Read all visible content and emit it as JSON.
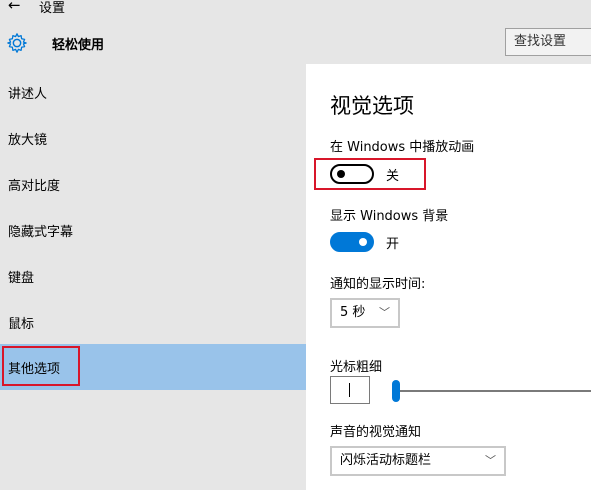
{
  "titlebar": {
    "back_glyph": "←",
    "app_title": "设置"
  },
  "header": {
    "icon": "gear-icon",
    "section_title": "轻松使用",
    "search_placeholder": "查找设置"
  },
  "sidebar": {
    "items": [
      {
        "label": "讲述人",
        "selected": false
      },
      {
        "label": "放大镜",
        "selected": false
      },
      {
        "label": "高对比度",
        "selected": false
      },
      {
        "label": "隐藏式字幕",
        "selected": false
      },
      {
        "label": "键盘",
        "selected": false
      },
      {
        "label": "鼠标",
        "selected": false
      },
      {
        "label": "其他选项",
        "selected": true
      }
    ]
  },
  "main": {
    "title": "视觉选项",
    "animations": {
      "label": "在 Windows 中播放动画",
      "state_text": "关",
      "on": false
    },
    "background": {
      "label": "显示 Windows 背景",
      "state_text": "开",
      "on": true
    },
    "notification": {
      "label": "通知的显示时间:",
      "value": "5 秒"
    },
    "cursor": {
      "label": "光标粗细",
      "thickness": 1
    },
    "sound_visual": {
      "label": "声音的视觉通知",
      "value": "闪烁活动标题栏"
    }
  },
  "colors": {
    "accent": "#0078d7",
    "selected_bg": "#99c3ea",
    "sidebar_bg": "#e6e6e6",
    "highlight_red": "#d8162a"
  }
}
